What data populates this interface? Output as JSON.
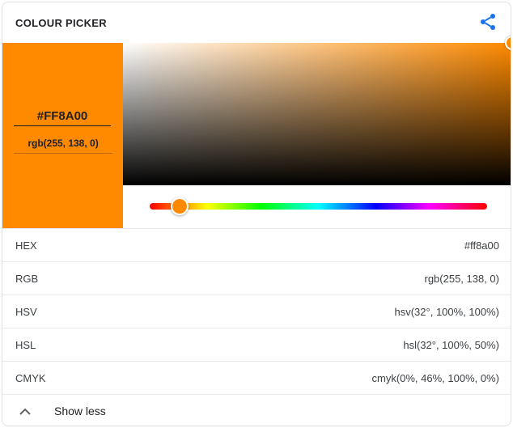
{
  "header": {
    "title": "COLOUR PICKER",
    "share_icon": "share-icon"
  },
  "colors": {
    "selected": "#ff8a00",
    "hue_color": "#ff8a00",
    "accent": "#1a73e8"
  },
  "picker": {
    "hex_value": "#FF8A00",
    "rgb_text": "rgb(255, 138, 0)",
    "hue_degrees": 32,
    "saturation_percent": 100,
    "value_percent": 100
  },
  "formats": [
    {
      "label": "HEX",
      "value": "#ff8a00"
    },
    {
      "label": "RGB",
      "value": "rgb(255, 138, 0)"
    },
    {
      "label": "HSV",
      "value": "hsv(32°, 100%, 100%)"
    },
    {
      "label": "HSL",
      "value": "hsl(32°, 100%, 50%)"
    },
    {
      "label": "CMYK",
      "value": "cmyk(0%, 46%, 100%, 0%)"
    }
  ],
  "footer": {
    "toggle_label": "Show less",
    "toggle_icon": "chevron-up-icon"
  }
}
